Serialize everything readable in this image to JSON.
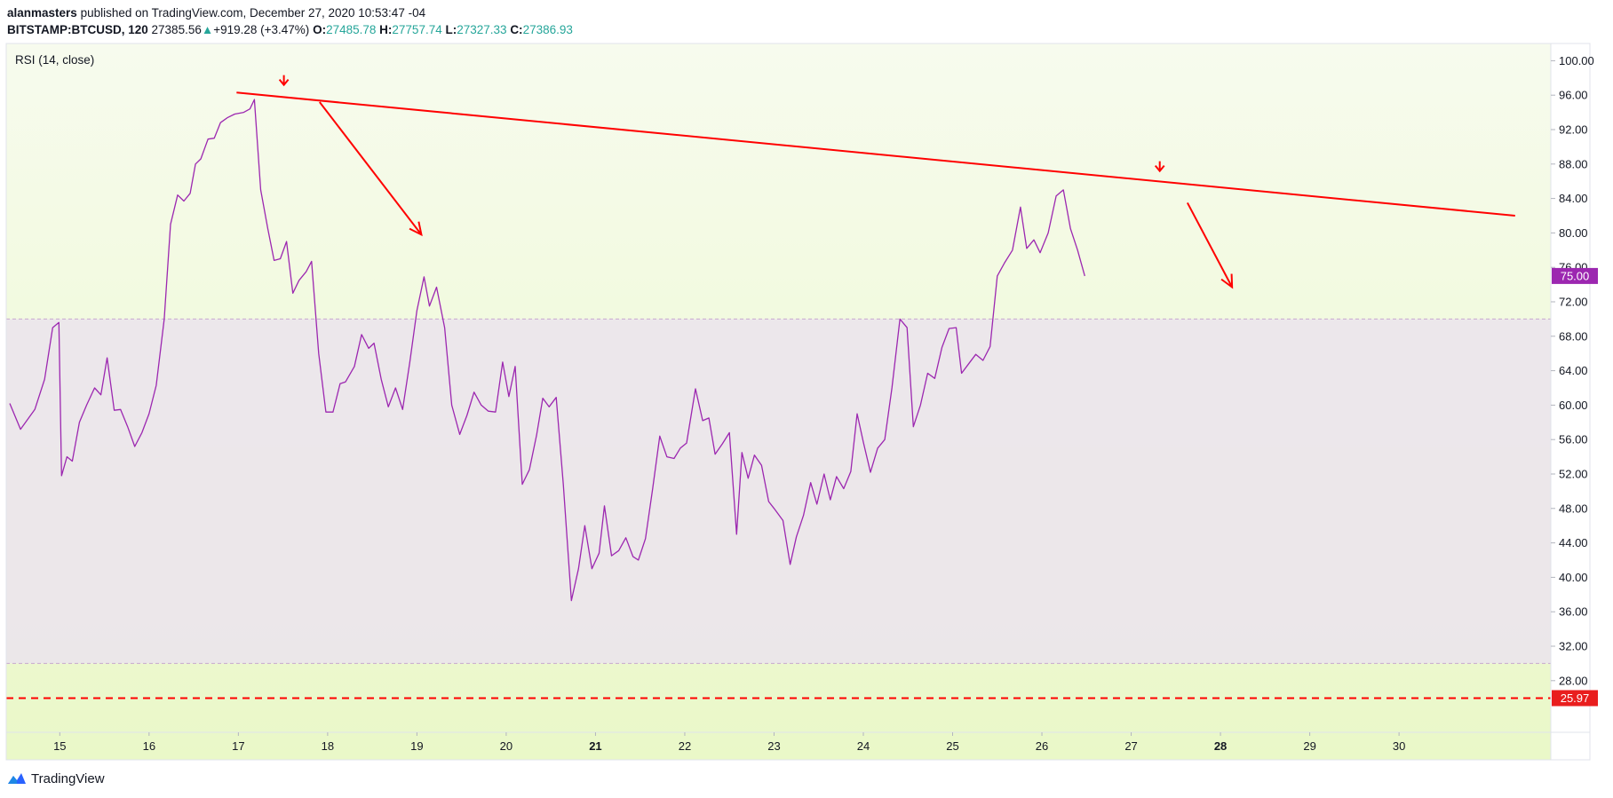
{
  "header": {
    "author": "alanmasters",
    "published_text": "published on TradingView.com, December 27, 2020 10:53:47 -04",
    "symbol": "BITSTAMP:BTCUSD, 120",
    "price": "27385.56",
    "change_arrow": "▲",
    "change": "+919.28 (+3.47%)",
    "open_label": "O:",
    "open": "27485.78",
    "high_label": "H:",
    "high": "27757.74",
    "low_label": "L:",
    "low": "27327.33",
    "close_label": "C:",
    "close": "27386.93"
  },
  "footer": {
    "brand": "TradingView",
    "logo_icon": "tradingview-logo-icon"
  },
  "colors": {
    "rsi_line": "#9c27b0",
    "band_fill": "#ebe4ec",
    "trend_line": "#ff0000",
    "current_badge": "#9c27b0",
    "marker_badge": "#e91e1e",
    "background_top": "#f7fbee",
    "background_bottom": "#eaf8c8"
  },
  "chart_data": {
    "type": "line",
    "title": "RSI (14, close)",
    "xlabel": "",
    "ylabel": "",
    "ylim": [
      22,
      102
    ],
    "xlim": [
      14.4,
      31.7
    ],
    "x_ticks": [
      {
        "x": 15,
        "label": "15",
        "bold": false
      },
      {
        "x": 16,
        "label": "16",
        "bold": false
      },
      {
        "x": 17,
        "label": "17",
        "bold": false
      },
      {
        "x": 18,
        "label": "18",
        "bold": false
      },
      {
        "x": 19,
        "label": "19",
        "bold": false
      },
      {
        "x": 20,
        "label": "20",
        "bold": false
      },
      {
        "x": 21,
        "label": "21",
        "bold": true
      },
      {
        "x": 22,
        "label": "22",
        "bold": false
      },
      {
        "x": 23,
        "label": "23",
        "bold": false
      },
      {
        "x": 24,
        "label": "24",
        "bold": false
      },
      {
        "x": 25,
        "label": "25",
        "bold": false
      },
      {
        "x": 26,
        "label": "26",
        "bold": false
      },
      {
        "x": 27,
        "label": "27",
        "bold": false
      },
      {
        "x": 28,
        "label": "28",
        "bold": true
      },
      {
        "x": 29,
        "label": "29",
        "bold": false
      },
      {
        "x": 30,
        "label": "30",
        "bold": false
      }
    ],
    "y_ticks": [
      "100.00",
      "96.00",
      "92.00",
      "88.00",
      "84.00",
      "80.00",
      "76.00",
      "72.00",
      "68.00",
      "64.00",
      "60.00",
      "56.00",
      "52.00",
      "48.00",
      "44.00",
      "40.00",
      "36.00",
      "32.00",
      "28.00"
    ],
    "bands": {
      "upper": 70,
      "lower": 30
    },
    "series": [
      {
        "values": [
          [
            14.44,
            60.2
          ],
          [
            14.56,
            57.2
          ],
          [
            14.72,
            59.5
          ],
          [
            14.83,
            63
          ],
          [
            14.92,
            69
          ],
          [
            14.99,
            69.6
          ],
          [
            15.02,
            51.8
          ],
          [
            15.08,
            54
          ],
          [
            15.14,
            53.5
          ],
          [
            15.22,
            58
          ],
          [
            15.3,
            60
          ],
          [
            15.39,
            62
          ],
          [
            15.46,
            61.2
          ],
          [
            15.53,
            65.5
          ],
          [
            15.61,
            59.4
          ],
          [
            15.68,
            59.5
          ],
          [
            15.76,
            57.5
          ],
          [
            15.84,
            55.2
          ],
          [
            15.92,
            56.8
          ],
          [
            16.0,
            59
          ],
          [
            16.08,
            62.3
          ],
          [
            16.17,
            70
          ],
          [
            16.24,
            81
          ],
          [
            16.32,
            84.4
          ],
          [
            16.39,
            83.7
          ],
          [
            16.46,
            84.6
          ],
          [
            16.52,
            88
          ],
          [
            16.58,
            88.6
          ],
          [
            16.66,
            90.9
          ],
          [
            16.73,
            91
          ],
          [
            16.8,
            92.8
          ],
          [
            16.88,
            93.4
          ],
          [
            16.96,
            93.8
          ],
          [
            17.06,
            94
          ],
          [
            17.13,
            94.4
          ],
          [
            17.18,
            95.5
          ],
          [
            17.25,
            85
          ],
          [
            17.33,
            80.5
          ],
          [
            17.4,
            76.8
          ],
          [
            17.47,
            77
          ],
          [
            17.54,
            79
          ],
          [
            17.61,
            73
          ],
          [
            17.68,
            74.5
          ],
          [
            17.76,
            75.5
          ],
          [
            17.82,
            76.7
          ],
          [
            17.9,
            66
          ],
          [
            17.98,
            59.2
          ],
          [
            18.06,
            59.2
          ],
          [
            18.14,
            62.5
          ],
          [
            18.2,
            62.7
          ],
          [
            18.3,
            64.5
          ],
          [
            18.38,
            68.2
          ],
          [
            18.46,
            66.6
          ],
          [
            18.52,
            67.2
          ],
          [
            18.6,
            63
          ],
          [
            18.68,
            59.8
          ],
          [
            18.76,
            62
          ],
          [
            18.84,
            59.5
          ],
          [
            18.92,
            65
          ],
          [
            19.0,
            71
          ],
          [
            19.08,
            74.9
          ],
          [
            19.14,
            71.5
          ],
          [
            19.22,
            73.7
          ],
          [
            19.31,
            69
          ],
          [
            19.39,
            60
          ],
          [
            19.48,
            56.6
          ],
          [
            19.56,
            58.8
          ],
          [
            19.64,
            61.5
          ],
          [
            19.72,
            60
          ],
          [
            19.8,
            59.3
          ],
          [
            19.88,
            59.2
          ],
          [
            19.96,
            65
          ],
          [
            20.03,
            61
          ],
          [
            20.1,
            64.5
          ],
          [
            20.18,
            50.8
          ],
          [
            20.26,
            52.5
          ],
          [
            20.34,
            56.5
          ],
          [
            20.41,
            60.8
          ],
          [
            20.48,
            59.8
          ],
          [
            20.56,
            60.9
          ],
          [
            20.64,
            50.8
          ],
          [
            20.73,
            37.3
          ],
          [
            20.81,
            41
          ],
          [
            20.88,
            46
          ],
          [
            20.96,
            41
          ],
          [
            21.04,
            42.8
          ],
          [
            21.1,
            48.3
          ],
          [
            21.18,
            42.5
          ],
          [
            21.26,
            43.1
          ],
          [
            21.34,
            44.6
          ],
          [
            21.42,
            42.4
          ],
          [
            21.48,
            42
          ],
          [
            21.56,
            44.5
          ],
          [
            21.64,
            50.3
          ],
          [
            21.72,
            56.4
          ],
          [
            21.8,
            54
          ],
          [
            21.88,
            53.8
          ],
          [
            21.95,
            55
          ],
          [
            22.02,
            55.6
          ],
          [
            22.12,
            61.9
          ],
          [
            22.2,
            58.2
          ],
          [
            22.27,
            58.5
          ],
          [
            22.34,
            54.3
          ],
          [
            22.42,
            55.5
          ],
          [
            22.5,
            56.8
          ],
          [
            22.58,
            45
          ],
          [
            22.64,
            54.5
          ],
          [
            22.71,
            51.5
          ],
          [
            22.78,
            54.2
          ],
          [
            22.86,
            53
          ],
          [
            22.94,
            48.8
          ],
          [
            23.0,
            48
          ],
          [
            23.1,
            46.6
          ],
          [
            23.18,
            41.5
          ],
          [
            23.25,
            44.7
          ],
          [
            23.33,
            47.2
          ],
          [
            23.41,
            51
          ],
          [
            23.48,
            48.5
          ],
          [
            23.56,
            52
          ],
          [
            23.63,
            49
          ],
          [
            23.7,
            51.7
          ],
          [
            23.78,
            50.3
          ],
          [
            23.86,
            52.3
          ],
          [
            23.93,
            59
          ],
          [
            24.0,
            55.7
          ],
          [
            24.08,
            52.2
          ],
          [
            24.16,
            55
          ],
          [
            24.24,
            56
          ],
          [
            24.32,
            62
          ],
          [
            24.41,
            70
          ],
          [
            24.49,
            69
          ],
          [
            24.56,
            57.5
          ],
          [
            24.64,
            60
          ],
          [
            24.72,
            63.7
          ],
          [
            24.8,
            63.1
          ],
          [
            24.88,
            66.7
          ],
          [
            24.96,
            68.9
          ],
          [
            25.04,
            69
          ],
          [
            25.1,
            63.7
          ],
          [
            25.18,
            64.8
          ],
          [
            25.26,
            65.9
          ],
          [
            25.34,
            65.2
          ],
          [
            25.42,
            66.8
          ],
          [
            25.5,
            75
          ],
          [
            25.58,
            76.5
          ],
          [
            25.67,
            78
          ],
          [
            25.76,
            83
          ],
          [
            25.83,
            78.2
          ],
          [
            25.91,
            79.2
          ],
          [
            25.98,
            77.7
          ],
          [
            26.07,
            80
          ],
          [
            26.16,
            84.3
          ],
          [
            26.24,
            85
          ],
          [
            26.32,
            80.5
          ],
          [
            26.4,
            78
          ],
          [
            26.48,
            75
          ]
        ]
      }
    ],
    "trendline": {
      "from": [
        16.98,
        96.3
      ],
      "to": [
        31.3,
        82
      ]
    },
    "horizontal_line": {
      "y": 25.97
    },
    "annotations": {
      "down_markers": [
        [
          17.51,
          97.5
        ],
        [
          27.32,
          87.5
        ]
      ],
      "arrows": [
        {
          "from": [
            17.91,
            95.2
          ],
          "to": [
            19.05,
            79.8
          ]
        },
        {
          "from": [
            27.63,
            83.5
          ],
          "to": [
            28.13,
            73.7
          ]
        }
      ]
    },
    "current_value": {
      "value": 75,
      "label": "75.00"
    },
    "marker_value": {
      "value": 25.97,
      "label": "25.97"
    }
  }
}
